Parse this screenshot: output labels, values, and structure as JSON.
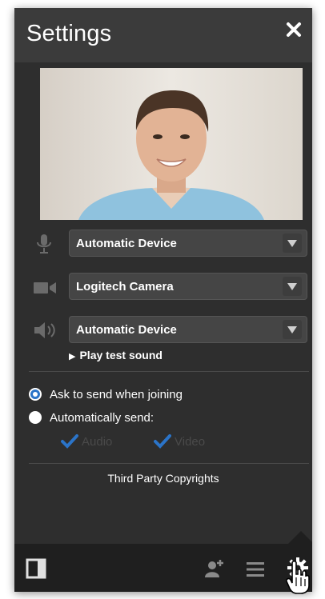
{
  "header": {
    "title": "Settings",
    "close_icon": "close-icon"
  },
  "devices": {
    "microphone": {
      "icon": "microphone-icon",
      "value": "Automatic Device"
    },
    "camera": {
      "icon": "camera-icon",
      "value": "Logitech Camera"
    },
    "speaker": {
      "icon": "speaker-icon",
      "value": "Automatic Device"
    }
  },
  "play_test_sound": "Play test sound",
  "send_options": {
    "ask_label": "Ask to send when joining",
    "ask_selected": true,
    "auto_label": "Automatically send:",
    "auto_selected": false,
    "audio_label": "Audio",
    "video_label": "Video"
  },
  "copyright_link": "Third Party Copyrights",
  "footer": {
    "icons": [
      "panel-toggle-icon",
      "add-participant-icon",
      "menu-icon",
      "gear-icon"
    ]
  },
  "colors": {
    "panel": "#2e2e2e",
    "header": "#3b3b3b",
    "footer": "#1f1f1f",
    "accent": "#2b74c8"
  }
}
